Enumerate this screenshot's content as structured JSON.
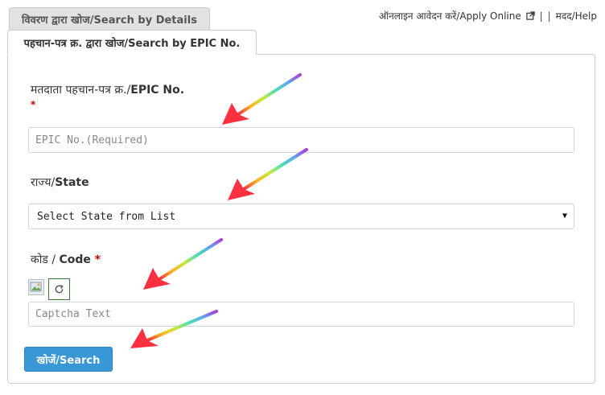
{
  "tabs": {
    "details_label": "विवरण द्वारा खोज/Search by Details",
    "epic_label": "पहचान-पत्र क्र. द्वारा खोज/Search by EPIC No."
  },
  "header_links": {
    "apply_online": "ऑनलाइन आवेदन करें/Apply Online",
    "separator": "|",
    "help": "मदद/Help"
  },
  "form": {
    "epic": {
      "label_hi": "मतदाता पहचान-पत्र क्र./",
      "label_en": "EPIC No.",
      "required_mark": "*",
      "placeholder": "EPIC No.(Required)"
    },
    "state": {
      "label_hi": "राज्य/",
      "label_en": "State",
      "selected": "Select State from List"
    },
    "captcha": {
      "label_hi": "कोड / ",
      "label_en": "Code",
      "required_mark": "*",
      "placeholder": "Captcha Text"
    },
    "search_button": "खोजें/Search"
  },
  "colors": {
    "primary_button": "#3a97d6",
    "required": "#cc0000",
    "inactive_tab": "#e2e2e2"
  },
  "icons": {
    "external_link": "external-link-icon",
    "refresh": "refresh-icon",
    "dropdown": "chevron-down-icon",
    "annotation": "rainbow-arrow-icon"
  }
}
